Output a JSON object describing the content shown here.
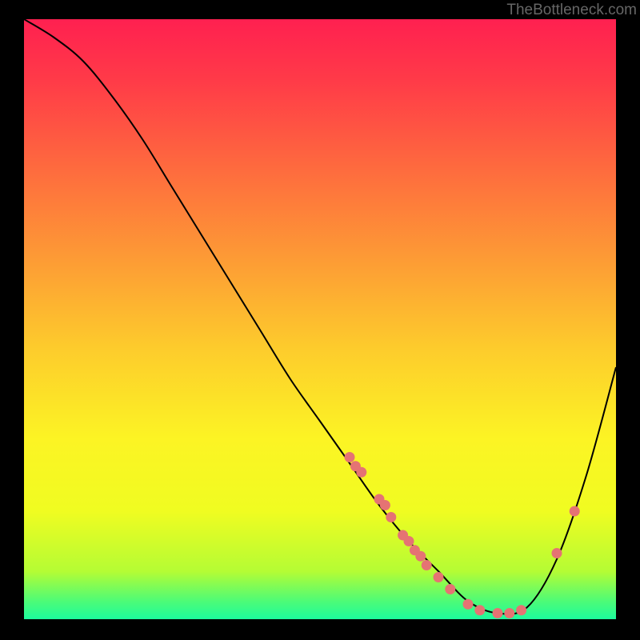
{
  "watermark": "TheBottleneck.com",
  "chart_data": {
    "type": "line",
    "title": "",
    "xlabel": "",
    "ylabel": "",
    "xlim": [
      0,
      100
    ],
    "ylim": [
      0,
      100
    ],
    "curve": {
      "x": [
        0,
        5,
        10,
        15,
        20,
        25,
        30,
        35,
        40,
        45,
        50,
        55,
        60,
        65,
        70,
        75,
        80,
        85,
        90,
        95,
        100
      ],
      "y": [
        100,
        97,
        93,
        87,
        80,
        72,
        64,
        56,
        48,
        40,
        33,
        26,
        19,
        13,
        8,
        3,
        1,
        2,
        10,
        24,
        42
      ]
    },
    "scatter_points": [
      {
        "x": 55,
        "y": 27
      },
      {
        "x": 56,
        "y": 25.5
      },
      {
        "x": 57,
        "y": 24.5
      },
      {
        "x": 60,
        "y": 20
      },
      {
        "x": 61,
        "y": 19
      },
      {
        "x": 62,
        "y": 17
      },
      {
        "x": 64,
        "y": 14
      },
      {
        "x": 65,
        "y": 13
      },
      {
        "x": 66,
        "y": 11.5
      },
      {
        "x": 67,
        "y": 10.5
      },
      {
        "x": 68,
        "y": 9
      },
      {
        "x": 70,
        "y": 7
      },
      {
        "x": 72,
        "y": 5
      },
      {
        "x": 75,
        "y": 2.5
      },
      {
        "x": 77,
        "y": 1.5
      },
      {
        "x": 80,
        "y": 1
      },
      {
        "x": 82,
        "y": 1
      },
      {
        "x": 84,
        "y": 1.5
      },
      {
        "x": 90,
        "y": 11
      },
      {
        "x": 93,
        "y": 18
      }
    ],
    "gradient_stops": [
      {
        "offset": 0,
        "color": "#ff2050"
      },
      {
        "offset": 0.1,
        "color": "#ff3a48"
      },
      {
        "offset": 0.25,
        "color": "#fe6b3e"
      },
      {
        "offset": 0.4,
        "color": "#fd9b35"
      },
      {
        "offset": 0.55,
        "color": "#fdcc2c"
      },
      {
        "offset": 0.7,
        "color": "#fcf424"
      },
      {
        "offset": 0.82,
        "color": "#f0fc21"
      },
      {
        "offset": 0.92,
        "color": "#b5fc34"
      },
      {
        "offset": 0.97,
        "color": "#4dfb77"
      },
      {
        "offset": 1.0,
        "color": "#1cfb9d"
      }
    ],
    "point_color": "#e57373"
  }
}
